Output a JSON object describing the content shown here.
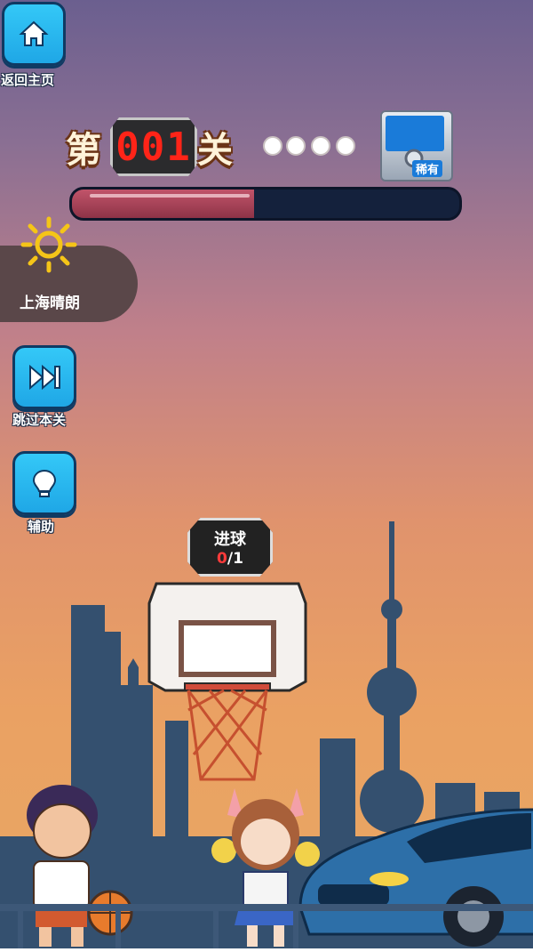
{
  "top_button": {
    "label": "返回主页",
    "icon": "home-icon"
  },
  "level": {
    "prefix": "第",
    "number": "001",
    "suffix": "关"
  },
  "progress": {
    "dots": 4,
    "fill_fraction": 0.47
  },
  "badge": {
    "label": "稀有",
    "icon": "camera-card-icon"
  },
  "weather": {
    "label": "上海晴朗",
    "icon": "sun-icon"
  },
  "side_buttons": [
    {
      "label": "跳过本关",
      "icon": "fast-forward-icon"
    },
    {
      "label": "辅助",
      "icon": "lightbulb-icon"
    }
  ],
  "score": {
    "title": "进球",
    "current": "0",
    "separator": "/",
    "target": "1"
  },
  "colors": {
    "sky_top": "#6b5f8f",
    "sky_bottom": "#e8a863",
    "button": "#1fa7e6",
    "digit": "#ff2418",
    "progress_fill": "#c1546a"
  }
}
